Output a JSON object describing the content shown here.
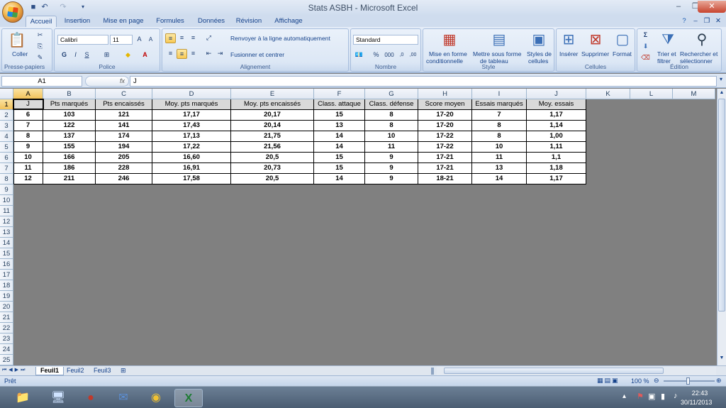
{
  "window": {
    "title": "Stats ASBH - Microsoft Excel"
  },
  "tabs": [
    "Accueil",
    "Insertion",
    "Mise en page",
    "Formules",
    "Données",
    "Révision",
    "Affichage"
  ],
  "ribbon": {
    "clipboard": {
      "label": "Presse-papiers",
      "paste": "Coller"
    },
    "font": {
      "label": "Police",
      "name": "Calibri",
      "size": "11",
      "bold": "G",
      "italic": "I",
      "underline": "S"
    },
    "alignment": {
      "label": "Alignement",
      "wrap": "Renvoyer à la ligne automatiquement",
      "merge": "Fusionner et centrer"
    },
    "number": {
      "label": "Nombre",
      "format": "Standard",
      "percent": "%",
      "thousands": "000",
      "dec_more": "⁰‰",
      "dec_less": "‰⁰"
    },
    "style": {
      "label": "Style",
      "cond1": "Mise en forme",
      "cond2": "conditionnelle",
      "table1": "Mettre sous forme",
      "table2": "de tableau",
      "cell1": "Styles de",
      "cell2": "cellules"
    },
    "cells": {
      "label": "Cellules",
      "insert": "Insérer",
      "delete": "Supprimer",
      "format": "Format"
    },
    "edit": {
      "label": "Édition",
      "sort1": "Trier et",
      "sort2": "filtrer",
      "find1": "Rechercher et",
      "find2": "sélectionner",
      "sigma": "Σ"
    }
  },
  "formula_bar": {
    "name_box": "A1",
    "fx": "fx",
    "content": "J"
  },
  "grid": {
    "columns": [
      "A",
      "B",
      "C",
      "D",
      "E",
      "F",
      "G",
      "H",
      "I",
      "J",
      "K",
      "L",
      "M"
    ],
    "rows": [
      "1",
      "2",
      "3",
      "4",
      "5",
      "6",
      "7",
      "8",
      "9",
      "10",
      "11",
      "12",
      "13",
      "14",
      "15",
      "16",
      "17",
      "18",
      "19",
      "20",
      "21",
      "22",
      "23",
      "24",
      "25"
    ],
    "headers": [
      "J",
      "Pts marqués",
      "Pts encaissés",
      "Moy. pts marqués",
      "Moy. pts encaissés",
      "Class. attaque",
      "Class. défense",
      "Score moyen",
      "Essais marqués",
      "Moy. essais"
    ],
    "data": [
      [
        "6",
        "103",
        "121",
        "17,17",
        "20,17",
        "15",
        "8",
        "17-20",
        "7",
        "1,17"
      ],
      [
        "7",
        "122",
        "141",
        "17,43",
        "20,14",
        "13",
        "8",
        "17-20",
        "8",
        "1,14"
      ],
      [
        "8",
        "137",
        "174",
        "17,13",
        "21,75",
        "14",
        "10",
        "17-22",
        "8",
        "1,00"
      ],
      [
        "9",
        "155",
        "194",
        "17,22",
        "21,56",
        "14",
        "11",
        "17-22",
        "10",
        "1,11"
      ],
      [
        "10",
        "166",
        "205",
        "16,60",
        "20,5",
        "15",
        "9",
        "17-21",
        "11",
        "1,1"
      ],
      [
        "11",
        "186",
        "228",
        "16,91",
        "20,73",
        "15",
        "9",
        "17-21",
        "13",
        "1,18"
      ],
      [
        "12",
        "211",
        "246",
        "17,58",
        "20,5",
        "14",
        "9",
        "18-21",
        "14",
        "1,17"
      ]
    ]
  },
  "sheets": [
    "Feuil1",
    "Feuil2",
    "Feuil3"
  ],
  "status": {
    "ready": "Prêt",
    "zoom": "100 %"
  },
  "taskbar": {
    "time": "22:43",
    "date": "30/11/2013"
  }
}
